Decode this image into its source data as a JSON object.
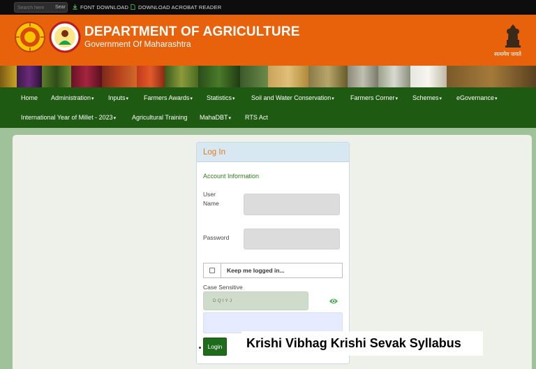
{
  "topbar": {
    "search_placeholder": "Search here",
    "search_button": "Sear",
    "links": [
      "FONT DOWNLOAD",
      "DOWNLOAD ACROBAT READER"
    ]
  },
  "header": {
    "title": "DEPARTMENT OF AGRICULTURE",
    "subtitle": "Government Of Maharashtra",
    "motto": "सत्यमेव जयते"
  },
  "nav": {
    "items": [
      {
        "label": "Home",
        "caret": ""
      },
      {
        "label": "Administration",
        "caret": "▾"
      },
      {
        "label": "Inputs",
        "caret": "▾"
      },
      {
        "label": "Farmers Awards",
        "caret": "▾"
      },
      {
        "label": "Statistics",
        "caret": "▾"
      },
      {
        "label": "Soil and Water Conservation",
        "caret": "▾"
      },
      {
        "label": "Farmers Corner",
        "caret": "▾"
      },
      {
        "label": "Schemes",
        "caret": "▾"
      },
      {
        "label": "eGovernance",
        "caret": "▾"
      },
      {
        "label": "International Year of Millet - 2023",
        "caret": "▾"
      },
      {
        "label": "Agricultural Training",
        "caret": ""
      },
      {
        "label": "MahaDBT",
        "caret": "▾"
      },
      {
        "label": "RTS Act",
        "caret": ""
      }
    ]
  },
  "login": {
    "title": "Log In",
    "section": "Account Information",
    "username_label_1": "User",
    "username_label_2": "Name",
    "username_value": "",
    "password_label": "Password",
    "password_value": "",
    "remember_label": "Keep me logged in...",
    "case_label": "Case Sensitive",
    "captcha_text": "DQIYJ",
    "captcha_value": "",
    "button": "Login"
  },
  "overlay_caption": "Krishi Vibhag Krishi Sevak Syllabus",
  "colors": {
    "header_orange": "#e8620c",
    "nav_green": "#1e5a12",
    "login_green": "#1f6b1c",
    "title_orange": "#e07c1c"
  }
}
